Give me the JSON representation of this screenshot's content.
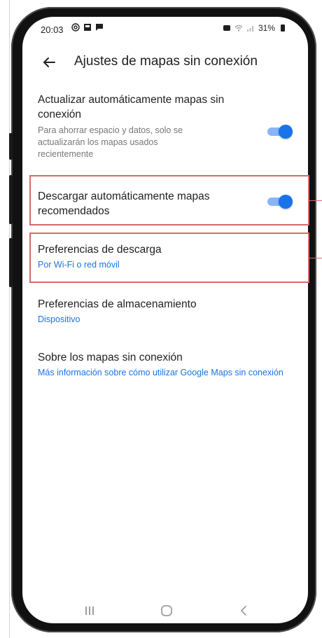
{
  "status_bar": {
    "time": "20:03",
    "battery": "31%"
  },
  "app_bar": {
    "title": "Ajustes de mapas sin conexión",
    "back_icon": "arrow-back-icon"
  },
  "settings": {
    "auto_update": {
      "title": "Actualizar automáticamente mapas sin conexión",
      "description": "Para ahorrar espacio y datos, solo se actualizarán los mapas usados recientemente",
      "toggle_on": true
    },
    "auto_download": {
      "title": "Descargar automáticamente mapas recomendados",
      "toggle_on": true
    },
    "download_prefs": {
      "title": "Preferencias de descarga",
      "value": "Por Wi-Fi o red móvil"
    },
    "storage_prefs": {
      "title": "Preferencias de almacenamiento",
      "value": "Dispositivo"
    },
    "about": {
      "title": "Sobre los mapas sin conexión",
      "link": "Más información sobre cómo utilizar Google Maps sin conexión"
    }
  },
  "nav_bar": {
    "recents_icon": "recents-icon",
    "home_icon": "home-icon",
    "back_icon": "nav-back-icon"
  },
  "colors": {
    "accent": "#1a73e8",
    "track": "#8ab4f8",
    "highlight": "#d36a6a"
  }
}
